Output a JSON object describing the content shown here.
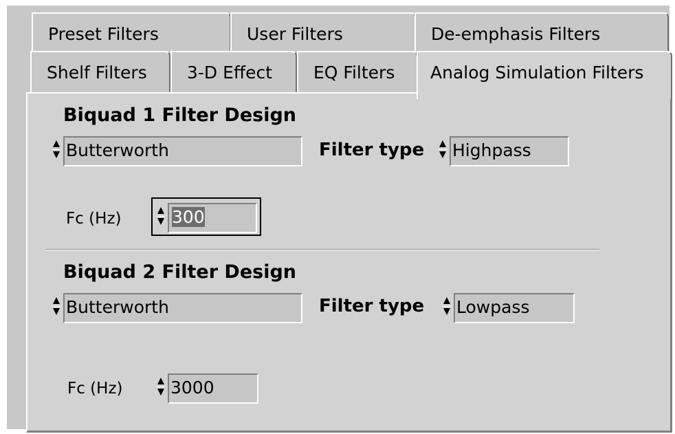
{
  "tabs_row1": [
    "Preset Filters",
    "User Filters",
    "De-emphasis Filters"
  ],
  "tabs_row2": [
    "Shelf Filters",
    "3-D Effect",
    "EQ Filters",
    "Analog Simulation Filters"
  ],
  "active_tab": "Analog Simulation Filters",
  "biquad1": {
    "heading": "Biquad 1 Filter Design",
    "design": "Butterworth",
    "filter_type_label": "Filter type",
    "filter_type": "Highpass",
    "fc_label": "Fc (Hz)",
    "fc": "300"
  },
  "biquad2": {
    "heading": "Biquad 2 Filter Design",
    "design": "Butterworth",
    "filter_type_label": "Filter type",
    "filter_type": "Lowpass",
    "fc_label": "Fc (Hz)",
    "fc": "3000"
  },
  "colors": {
    "panel": "#d2d2d2",
    "field": "#c6c6c6",
    "selection": "#6e6e6e"
  },
  "icons": {
    "ring_arrows": "up-down-spinner-icon"
  }
}
